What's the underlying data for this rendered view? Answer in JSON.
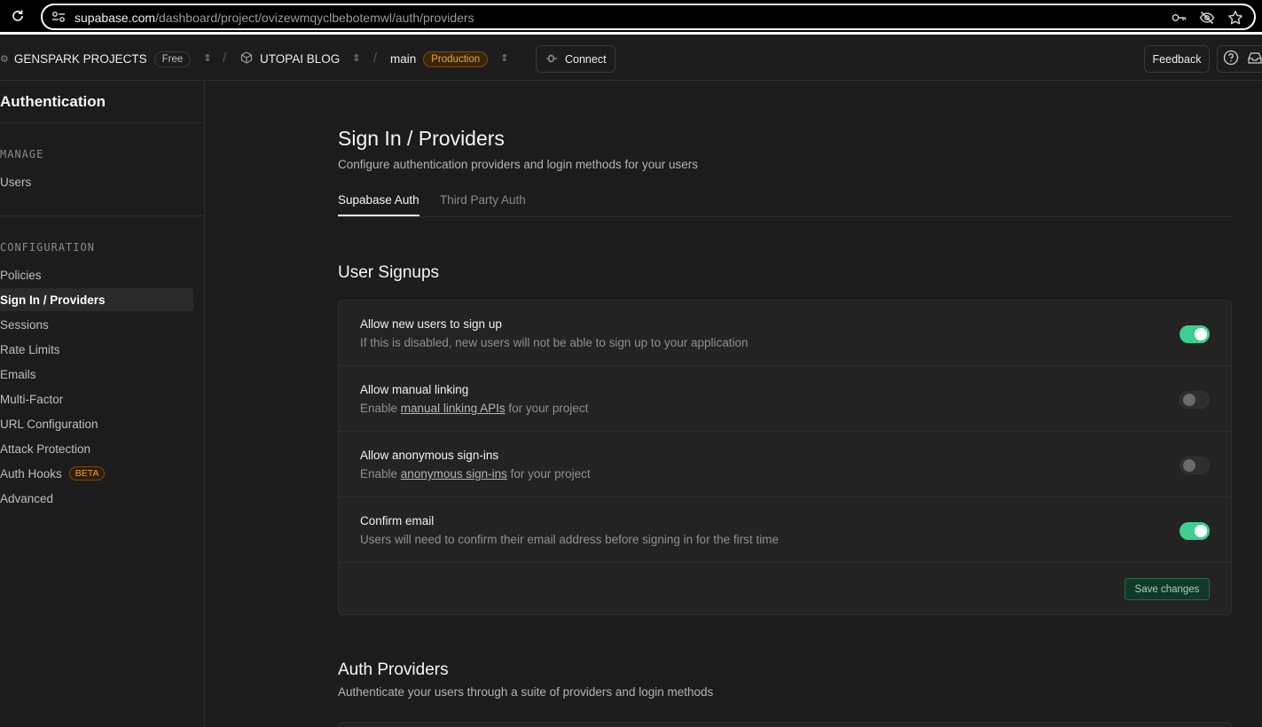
{
  "browser": {
    "url_domain": "supabase.com",
    "url_path": "/dashboard/project/ovizewmqyclbebotemwl/auth/providers"
  },
  "header": {
    "org": "GENSPARK PROJECTS",
    "org_plan": "Free",
    "project": "UTOPAI BLOG",
    "branch": "main",
    "branch_env": "Production",
    "connect_label": "Connect",
    "feedback_label": "Feedback"
  },
  "sidebar": {
    "title": "Authentication",
    "manage_label": "MANAGE",
    "manage_items": [
      "Users"
    ],
    "configuration_label": "CONFIGURATION",
    "config_items": [
      "Policies",
      "Sign In / Providers",
      "Sessions",
      "Rate Limits",
      "Emails",
      "Multi-Factor",
      "URL Configuration",
      "Attack Protection",
      "Auth Hooks",
      "Advanced"
    ],
    "auth_hooks_badge": "BETA",
    "active_item": "Sign In / Providers"
  },
  "main": {
    "title": "Sign In / Providers",
    "subtitle": "Configure authentication providers and login methods for your users",
    "tabs": [
      "Supabase Auth",
      "Third Party Auth"
    ],
    "active_tab": "Supabase Auth"
  },
  "user_signups": {
    "title": "User Signups",
    "rows": [
      {
        "label": "Allow new users to sign up",
        "desc_before": "If this is disabled, new users will not be able to sign up to your application",
        "link": "",
        "desc_after": "",
        "enabled": true
      },
      {
        "label": "Allow manual linking",
        "desc_before": "Enable ",
        "link": "manual linking APIs",
        "desc_after": " for your project",
        "enabled": false
      },
      {
        "label": "Allow anonymous sign-ins",
        "desc_before": "Enable ",
        "link": "anonymous sign-ins",
        "desc_after": " for your project",
        "enabled": false
      },
      {
        "label": "Confirm email",
        "desc_before": "Users will need to confirm their email address before signing in for the first time",
        "link": "",
        "desc_after": "",
        "enabled": true
      }
    ],
    "save_label": "Save changes"
  },
  "auth_providers": {
    "title": "Auth Providers",
    "subtitle": "Authenticate your users through a suite of providers and login methods"
  },
  "colors": {
    "accent": "#3ecf8e",
    "background": "#1c1c1c",
    "card": "#232323",
    "warning": "#f0a23b"
  }
}
